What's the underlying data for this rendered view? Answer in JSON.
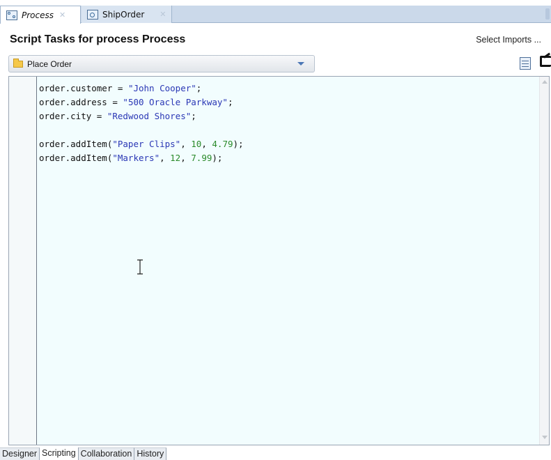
{
  "tabs": [
    {
      "label": "Process",
      "active": true,
      "icon": "process-icon"
    },
    {
      "label": "ShipOrder",
      "active": false,
      "icon": "service-icon"
    }
  ],
  "header": {
    "title": "Script Tasks for process Process",
    "select_imports": "Select Imports ..."
  },
  "task_selector": {
    "value": "Place Order",
    "icon": "folder-icon"
  },
  "editor": {
    "lines": [
      {
        "obj": "order.customer = ",
        "str": "\"John Cooper\"",
        "end": ";"
      },
      {
        "obj": "order.address = ",
        "str": "\"500 Oracle Parkway\"",
        "end": ";"
      },
      {
        "obj": "order.city = ",
        "str": "\"Redwood Shores\"",
        "end": ";"
      },
      {
        "obj": "order.addItem(",
        "str": "\"Paper Clips\"",
        "mid": ", ",
        "n1": "10",
        "sep": ", ",
        "n2": "4.79",
        "end": ");"
      },
      {
        "obj": "order.addItem(",
        "str": "\"Markers\"",
        "mid": ", ",
        "n1": "12",
        "sep": ", ",
        "n2": "7.99",
        "end": ");"
      }
    ]
  },
  "bottom_tabs": [
    "Designer",
    "Scripting",
    "Collaboration",
    "History"
  ],
  "active_bottom_tab": "Scripting",
  "colors": {
    "string": "#2a37b5",
    "number": "#2a8a2a",
    "tabbar": "#cbd9ea"
  }
}
